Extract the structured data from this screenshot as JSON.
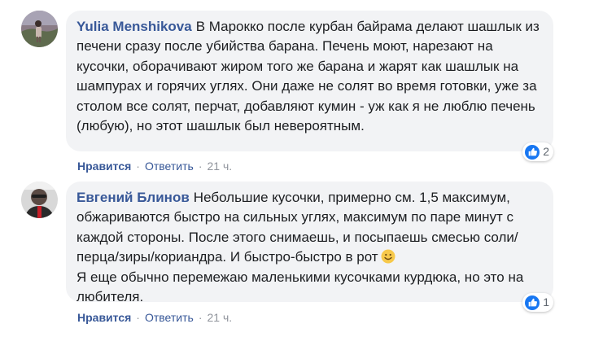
{
  "comments": [
    {
      "author": "Yulia Menshikova",
      "text": "В Марокко после курбан байрама делают шашлык из печени сразу после убийства барана. Печень моют, нарезают на кусочки, оборачивают жиром того же барана и жарят как шашлык на шампурах и горячих углях. Они даже не солят во время готовки, уже за столом все солят, перчат, добавляют кумин - уж как я не люблю печень (любую), но этот шашлык был невероятным.",
      "reaction_count": "2",
      "like_label": "Нравится",
      "reply_label": "Ответить",
      "time": "21 ч.",
      "avatar_icon": "woman-photo-avatar"
    },
    {
      "author": "Евгений Блинов",
      "text": "Небольшие кусочки, примерно см. 1,5 максимум, обжариваются быстро на сильных углях, максимум по паре минут с каждой стороны. После этого снимаешь, и посыпаешь смесью соли/перца/зиры/кориандра. И быстро-быстро в рот",
      "text_after_emoji": "Я еще обычно перемежаю маленькими кусочками курдюка, но это на любителя.",
      "emoji_icon": "smiley-icon",
      "reaction_count": "1",
      "like_label": "Нравится",
      "reply_label": "Ответить",
      "time": "21 ч.",
      "avatar_icon": "man-photo-avatar"
    }
  ],
  "colors": {
    "author": "#385898",
    "bubble": "#f2f3f5",
    "like_badge": "#1877f2",
    "meta": "#90949c"
  },
  "separator": "·"
}
